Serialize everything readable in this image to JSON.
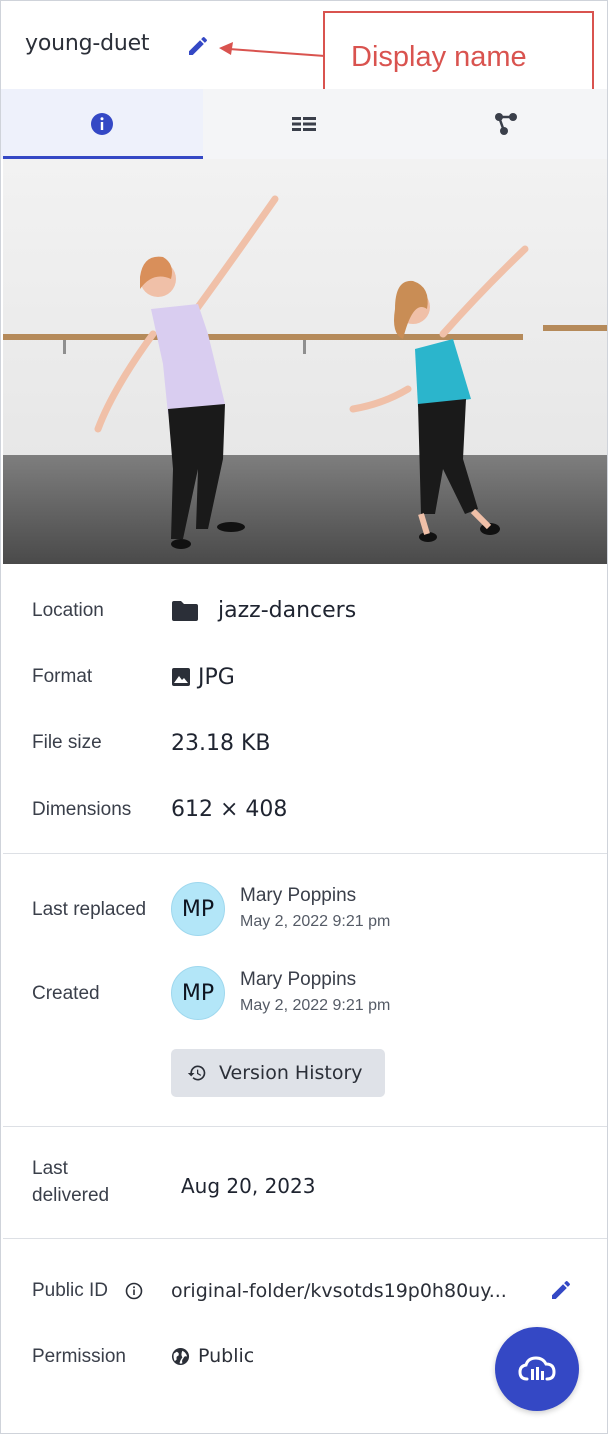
{
  "header": {
    "title": "young-duet",
    "edit_icon": "pencil-icon"
  },
  "annotation": {
    "label": "Display name",
    "color": "#d9534f"
  },
  "tabs": [
    {
      "name": "info",
      "icon": "info-icon",
      "active": true
    },
    {
      "name": "metadata",
      "icon": "list-icon",
      "active": false
    },
    {
      "name": "relations",
      "icon": "graph-icon",
      "active": false
    }
  ],
  "details": {
    "location_label": "Location",
    "location_value": "jazz-dancers",
    "format_label": "Format",
    "format_value": "JPG",
    "filesize_label": "File size",
    "filesize_value": "23.18 KB",
    "dimensions_label": "Dimensions",
    "dimensions_value": "612 × 408"
  },
  "activity": {
    "last_replaced_label": "Last replaced",
    "created_label": "Created",
    "replaced_by": {
      "initials": "MP",
      "name": "Mary Poppins",
      "date": "May 2, 2022 9:21 pm"
    },
    "created_by": {
      "initials": "MP",
      "name": "Mary Poppins",
      "date": "May 2, 2022 9:21 pm"
    },
    "version_history_label": "Version History"
  },
  "delivery": {
    "label_line1": "Last",
    "label_line2": "delivered",
    "value": "Aug 20, 2023"
  },
  "identity": {
    "public_id_label": "Public ID",
    "public_id_value": "original-folder/kvsotds19p0h80uy...",
    "permission_label": "Permission",
    "permission_value": "Public"
  },
  "colors": {
    "accent": "#3448c5",
    "avatar": "#b3e6f8"
  }
}
